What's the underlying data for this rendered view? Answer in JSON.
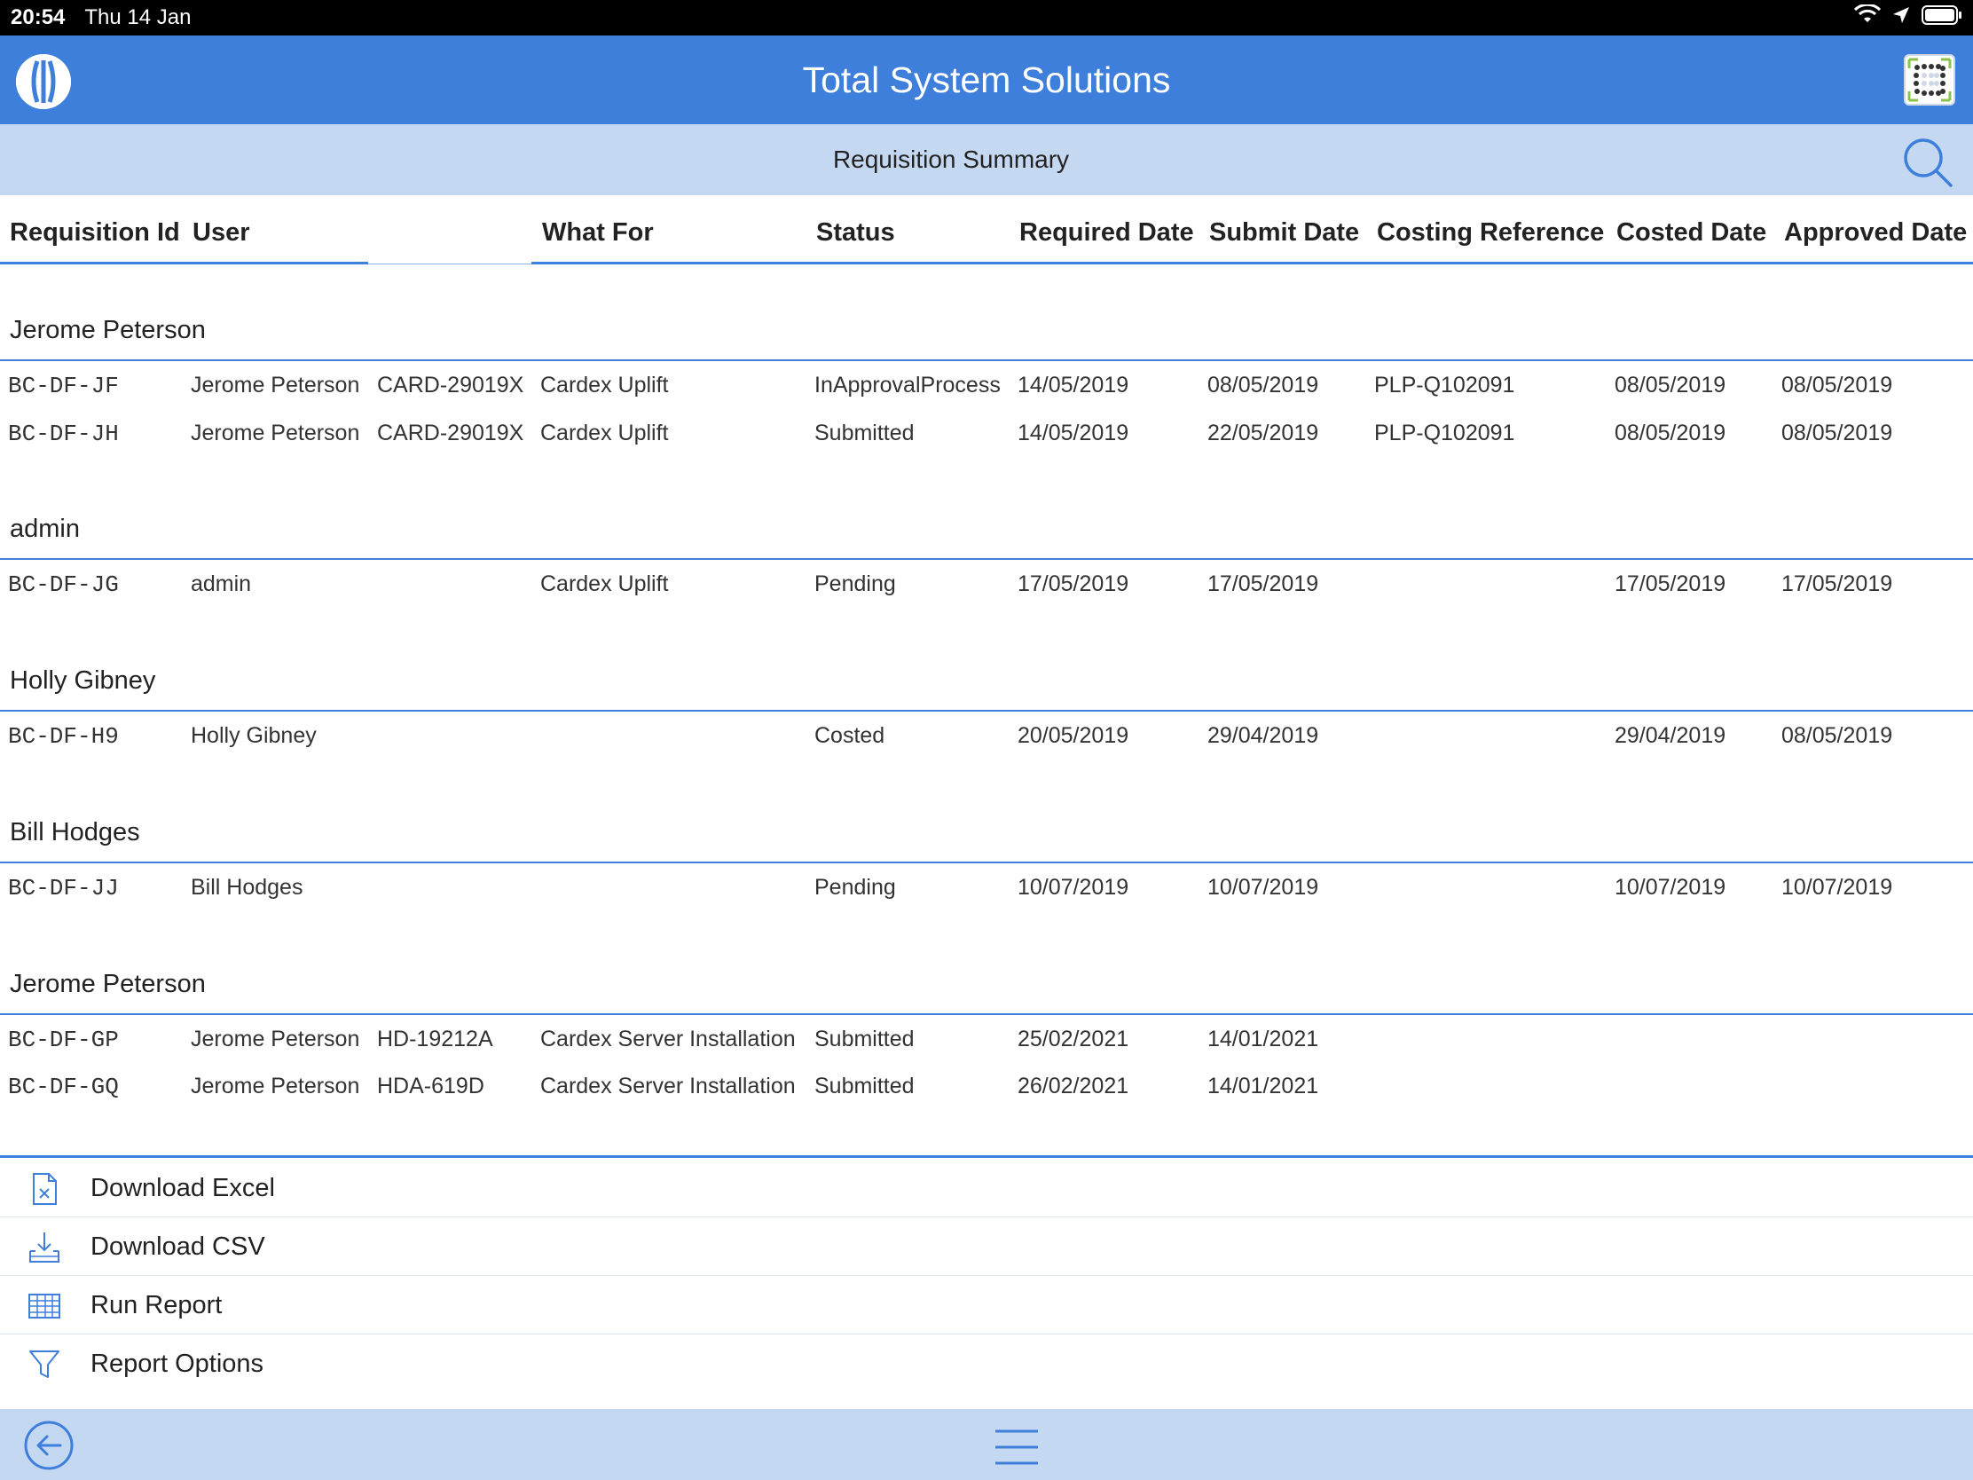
{
  "status_bar": {
    "time": "20:54",
    "date": "Thu 14 Jan",
    "icons": [
      "wifi-icon",
      "location-icon",
      "battery-icon"
    ]
  },
  "header": {
    "title": "Total System Solutions",
    "logo_icon": "company-logo-icon",
    "apps_icon": "apps-grid-icon"
  },
  "subheader": {
    "title": "Requisition Summary",
    "search_icon": "search-icon"
  },
  "columns": [
    "Requisition Id",
    "User",
    "What For",
    "Status",
    "Required Date",
    "Submit Date",
    "Costing Reference",
    "Costed Date",
    "Approved Date"
  ],
  "groups": [
    {
      "title": "Jerome Peterson",
      "rows": [
        {
          "id": "BC-DF-JF",
          "user": "Jerome Peterson",
          "ref": "CARD-29019X",
          "what_for": "Cardex Uplift",
          "status": "InApprovalProcess",
          "required": "14/05/2019",
          "submit": "08/05/2019",
          "costing_ref": "PLP-Q102091",
          "costed": "08/05/2019",
          "approved": "08/05/2019"
        },
        {
          "id": "BC-DF-JH",
          "user": "Jerome Peterson",
          "ref": "CARD-29019X",
          "what_for": "Cardex Uplift",
          "status": "Submitted",
          "required": "14/05/2019",
          "submit": "22/05/2019",
          "costing_ref": "PLP-Q102091",
          "costed": "08/05/2019",
          "approved": "08/05/2019"
        }
      ]
    },
    {
      "title": "admin",
      "rows": [
        {
          "id": "BC-DF-JG",
          "user": "admin",
          "ref": "",
          "what_for": "Cardex Uplift",
          "status": "Pending",
          "required": "17/05/2019",
          "submit": "17/05/2019",
          "costing_ref": "",
          "costed": "17/05/2019",
          "approved": "17/05/2019"
        }
      ]
    },
    {
      "title": "Holly Gibney",
      "rows": [
        {
          "id": "BC-DF-H9",
          "user": "Holly Gibney",
          "ref": "",
          "what_for": "",
          "status": "Costed",
          "required": "20/05/2019",
          "submit": "29/04/2019",
          "costing_ref": "",
          "costed": "29/04/2019",
          "approved": "08/05/2019"
        }
      ]
    },
    {
      "title": "Bill Hodges",
      "rows": [
        {
          "id": "BC-DF-JJ",
          "user": "Bill Hodges",
          "ref": "",
          "what_for": "",
          "status": "Pending",
          "required": "10/07/2019",
          "submit": "10/07/2019",
          "costing_ref": "",
          "costed": "10/07/2019",
          "approved": "10/07/2019"
        }
      ]
    },
    {
      "title": "Jerome Peterson",
      "rows": [
        {
          "id": "BC-DF-GP",
          "user": "Jerome Peterson",
          "ref": "HD-19212A",
          "what_for": "Cardex Server Installation",
          "status": "Submitted",
          "required": "25/02/2021",
          "submit": "14/01/2021",
          "costing_ref": "",
          "costed": "",
          "approved": ""
        },
        {
          "id": "BC-DF-GQ",
          "user": "Jerome Peterson",
          "ref": "HDA-619D",
          "what_for": "Cardex Server Installation",
          "status": "Submitted",
          "required": "26/02/2021",
          "submit": "14/01/2021",
          "costing_ref": "",
          "costed": "",
          "approved": ""
        }
      ]
    }
  ],
  "actions": [
    {
      "label": "Download Excel",
      "icon": "excel-file-icon"
    },
    {
      "label": "Download CSV",
      "icon": "download-tray-icon"
    },
    {
      "label": "Run Report",
      "icon": "table-grid-icon"
    },
    {
      "label": "Report Options",
      "icon": "filter-funnel-icon"
    }
  ],
  "bottom_bar": {
    "back_icon": "back-arrow-icon",
    "menu_icon": "hamburger-menu-icon"
  },
  "colors": {
    "primary": "#3f7fdc",
    "light_bar": "#c5d8f2",
    "status_bar": "#000000"
  }
}
